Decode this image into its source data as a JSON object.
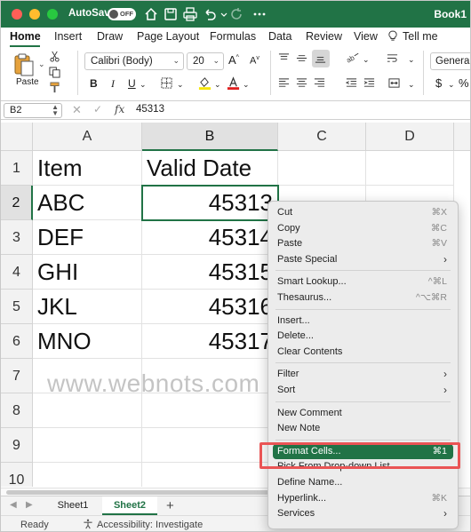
{
  "titlebar": {
    "autosave_label": "AutoSave",
    "autosave_state": "OFF",
    "book_title": "Book1",
    "colors": {
      "bar": "#217346"
    }
  },
  "ribbon_tabs": [
    "Home",
    "Insert",
    "Draw",
    "Page Layout",
    "Formulas",
    "Data",
    "Review",
    "View",
    "Tell me"
  ],
  "ribbon": {
    "paste_label": "Paste",
    "font_name": "Calibri (Body)",
    "font_size": "20",
    "bold": "B",
    "italic": "I",
    "underline": "U",
    "number_format": "General",
    "currency": "$",
    "percent": "%"
  },
  "formula_bar": {
    "name_box": "B2",
    "fx": "fx",
    "value": "45313"
  },
  "columns": [
    "A",
    "B",
    "C",
    "D"
  ],
  "rows": [
    "1",
    "2",
    "3",
    "4",
    "5",
    "6",
    "7",
    "8",
    "9",
    "10"
  ],
  "cells": {
    "A1": "Item",
    "B1": "Valid Date",
    "A2": "ABC",
    "B2": "45313",
    "A3": "DEF",
    "B3": "45314",
    "A4": "GHI",
    "B4": "45315",
    "A5": "JKL",
    "B5": "45316",
    "A6": "MNO",
    "B6": "45317"
  },
  "watermark": "www.webnots.com",
  "sheets": [
    "Sheet1",
    "Sheet2"
  ],
  "status": {
    "ready": "Ready",
    "accessibility": "Accessibility: Investigate"
  },
  "context_menu": {
    "items": [
      {
        "label": "Cut",
        "shortcut": "⌘X"
      },
      {
        "label": "Copy",
        "shortcut": "⌘C"
      },
      {
        "label": "Paste",
        "shortcut": "⌘V"
      },
      {
        "label": "Paste Special",
        "shortcut": "›"
      },
      {
        "label": "Smart Lookup...",
        "shortcut": "^⌘L"
      },
      {
        "label": "Thesaurus...",
        "shortcut": "^⌥⌘R"
      },
      {
        "label": "Insert..."
      },
      {
        "label": "Delete..."
      },
      {
        "label": "Clear Contents"
      },
      {
        "label": "Filter",
        "shortcut": "›"
      },
      {
        "label": "Sort",
        "shortcut": "›"
      },
      {
        "label": "New Comment"
      },
      {
        "label": "New Note"
      },
      {
        "label": "Format Cells...",
        "shortcut": "⌘1"
      },
      {
        "label": "Pick From Drop-down List..."
      },
      {
        "label": "Define Name..."
      },
      {
        "label": "Hyperlink...",
        "shortcut": "⌘K"
      },
      {
        "label": "Services",
        "shortcut": "›"
      }
    ],
    "highlight_color": "#217346",
    "callout_color": "#ea5455"
  }
}
